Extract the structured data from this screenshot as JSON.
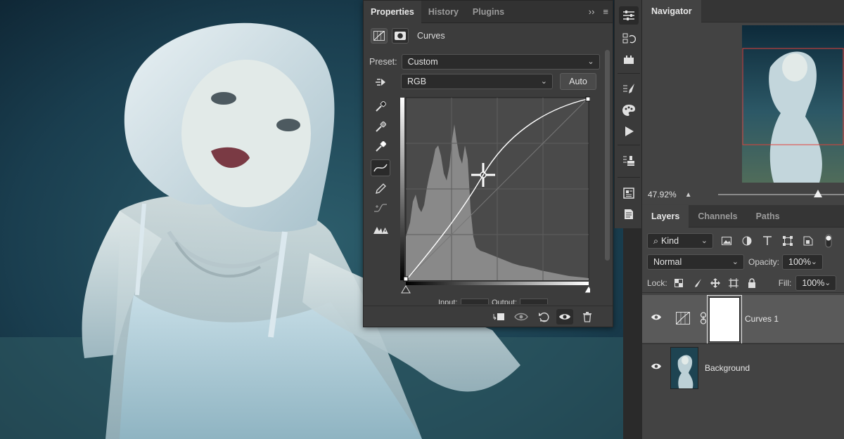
{
  "properties": {
    "tabs": [
      "Properties",
      "History",
      "Plugins"
    ],
    "title": "Curves",
    "preset_label": "Preset:",
    "preset_value": "Custom",
    "channel_value": "RGB",
    "auto_label": "Auto",
    "input_label": "Input:",
    "output_label": "Output:",
    "collapse_glyph": "››",
    "menu_glyph": "≡"
  },
  "navigator": {
    "tab": "Navigator",
    "zoom": "47.92%",
    "zoom_fraction": 0.79
  },
  "layers": {
    "tabs": [
      "Layers",
      "Channels",
      "Paths"
    ],
    "filter_kind": "Kind",
    "blend_mode": "Normal",
    "opacity_label": "Opacity:",
    "opacity_value": "100%",
    "lock_label": "Lock:",
    "fill_label": "Fill:",
    "fill_value": "100%",
    "items": [
      {
        "name": "Curves 1",
        "selected": true
      },
      {
        "name": "Background",
        "selected": false
      }
    ]
  },
  "colors": {
    "curve_line": "#ffffff",
    "histogram_fill": "#8c8c8c",
    "graph_bg": "#4a4a4a",
    "nav_view_box": "#e0403a"
  }
}
